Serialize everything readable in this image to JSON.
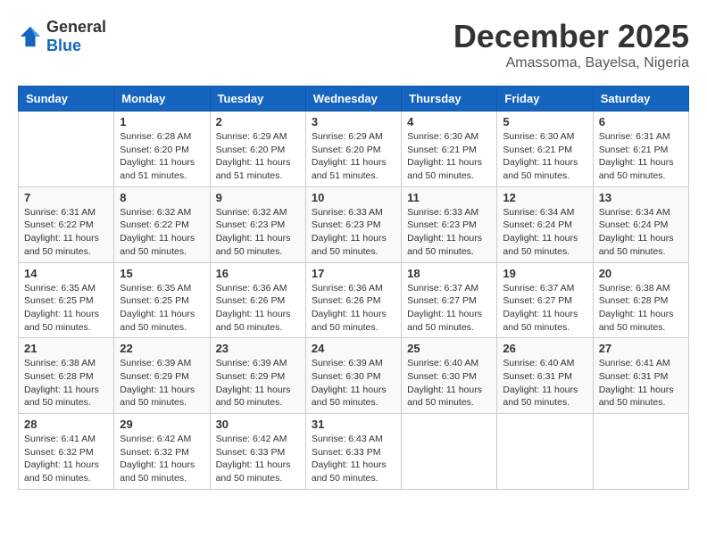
{
  "header": {
    "logo_general": "General",
    "logo_blue": "Blue",
    "month": "December 2025",
    "location": "Amassoma, Bayelsa, Nigeria"
  },
  "days_of_week": [
    "Sunday",
    "Monday",
    "Tuesday",
    "Wednesday",
    "Thursday",
    "Friday",
    "Saturday"
  ],
  "weeks": [
    [
      {
        "day": "",
        "info": ""
      },
      {
        "day": "1",
        "info": "Sunrise: 6:28 AM\nSunset: 6:20 PM\nDaylight: 11 hours\nand 51 minutes."
      },
      {
        "day": "2",
        "info": "Sunrise: 6:29 AM\nSunset: 6:20 PM\nDaylight: 11 hours\nand 51 minutes."
      },
      {
        "day": "3",
        "info": "Sunrise: 6:29 AM\nSunset: 6:20 PM\nDaylight: 11 hours\nand 51 minutes."
      },
      {
        "day": "4",
        "info": "Sunrise: 6:30 AM\nSunset: 6:21 PM\nDaylight: 11 hours\nand 50 minutes."
      },
      {
        "day": "5",
        "info": "Sunrise: 6:30 AM\nSunset: 6:21 PM\nDaylight: 11 hours\nand 50 minutes."
      },
      {
        "day": "6",
        "info": "Sunrise: 6:31 AM\nSunset: 6:21 PM\nDaylight: 11 hours\nand 50 minutes."
      }
    ],
    [
      {
        "day": "7",
        "info": "Sunrise: 6:31 AM\nSunset: 6:22 PM\nDaylight: 11 hours\nand 50 minutes."
      },
      {
        "day": "8",
        "info": "Sunrise: 6:32 AM\nSunset: 6:22 PM\nDaylight: 11 hours\nand 50 minutes."
      },
      {
        "day": "9",
        "info": "Sunrise: 6:32 AM\nSunset: 6:23 PM\nDaylight: 11 hours\nand 50 minutes."
      },
      {
        "day": "10",
        "info": "Sunrise: 6:33 AM\nSunset: 6:23 PM\nDaylight: 11 hours\nand 50 minutes."
      },
      {
        "day": "11",
        "info": "Sunrise: 6:33 AM\nSunset: 6:23 PM\nDaylight: 11 hours\nand 50 minutes."
      },
      {
        "day": "12",
        "info": "Sunrise: 6:34 AM\nSunset: 6:24 PM\nDaylight: 11 hours\nand 50 minutes."
      },
      {
        "day": "13",
        "info": "Sunrise: 6:34 AM\nSunset: 6:24 PM\nDaylight: 11 hours\nand 50 minutes."
      }
    ],
    [
      {
        "day": "14",
        "info": "Sunrise: 6:35 AM\nSunset: 6:25 PM\nDaylight: 11 hours\nand 50 minutes."
      },
      {
        "day": "15",
        "info": "Sunrise: 6:35 AM\nSunset: 6:25 PM\nDaylight: 11 hours\nand 50 minutes."
      },
      {
        "day": "16",
        "info": "Sunrise: 6:36 AM\nSunset: 6:26 PM\nDaylight: 11 hours\nand 50 minutes."
      },
      {
        "day": "17",
        "info": "Sunrise: 6:36 AM\nSunset: 6:26 PM\nDaylight: 11 hours\nand 50 minutes."
      },
      {
        "day": "18",
        "info": "Sunrise: 6:37 AM\nSunset: 6:27 PM\nDaylight: 11 hours\nand 50 minutes."
      },
      {
        "day": "19",
        "info": "Sunrise: 6:37 AM\nSunset: 6:27 PM\nDaylight: 11 hours\nand 50 minutes."
      },
      {
        "day": "20",
        "info": "Sunrise: 6:38 AM\nSunset: 6:28 PM\nDaylight: 11 hours\nand 50 minutes."
      }
    ],
    [
      {
        "day": "21",
        "info": "Sunrise: 6:38 AM\nSunset: 6:28 PM\nDaylight: 11 hours\nand 50 minutes."
      },
      {
        "day": "22",
        "info": "Sunrise: 6:39 AM\nSunset: 6:29 PM\nDaylight: 11 hours\nand 50 minutes."
      },
      {
        "day": "23",
        "info": "Sunrise: 6:39 AM\nSunset: 6:29 PM\nDaylight: 11 hours\nand 50 minutes."
      },
      {
        "day": "24",
        "info": "Sunrise: 6:39 AM\nSunset: 6:30 PM\nDaylight: 11 hours\nand 50 minutes."
      },
      {
        "day": "25",
        "info": "Sunrise: 6:40 AM\nSunset: 6:30 PM\nDaylight: 11 hours\nand 50 minutes."
      },
      {
        "day": "26",
        "info": "Sunrise: 6:40 AM\nSunset: 6:31 PM\nDaylight: 11 hours\nand 50 minutes."
      },
      {
        "day": "27",
        "info": "Sunrise: 6:41 AM\nSunset: 6:31 PM\nDaylight: 11 hours\nand 50 minutes."
      }
    ],
    [
      {
        "day": "28",
        "info": "Sunrise: 6:41 AM\nSunset: 6:32 PM\nDaylight: 11 hours\nand 50 minutes."
      },
      {
        "day": "29",
        "info": "Sunrise: 6:42 AM\nSunset: 6:32 PM\nDaylight: 11 hours\nand 50 minutes."
      },
      {
        "day": "30",
        "info": "Sunrise: 6:42 AM\nSunset: 6:33 PM\nDaylight: 11 hours\nand 50 minutes."
      },
      {
        "day": "31",
        "info": "Sunrise: 6:43 AM\nSunset: 6:33 PM\nDaylight: 11 hours\nand 50 minutes."
      },
      {
        "day": "",
        "info": ""
      },
      {
        "day": "",
        "info": ""
      },
      {
        "day": "",
        "info": ""
      }
    ]
  ]
}
